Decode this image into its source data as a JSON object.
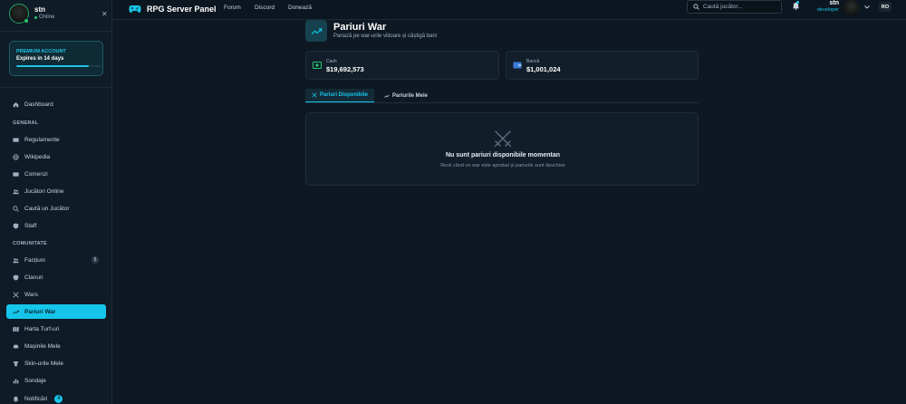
{
  "app": {
    "title": "RPG Server Panel"
  },
  "topnav": [
    "Forum",
    "Discord",
    "Donează"
  ],
  "search": {
    "placeholder": "Caută jucător..."
  },
  "user": {
    "name": "stn",
    "status": "Online",
    "role": "developer"
  },
  "language": "RO",
  "premium": {
    "title": "PREMIUM ACCOUNT",
    "expires": "Expires in 14 days",
    "progress_percent": 85
  },
  "sidebar": {
    "dashboard": "Dashboard",
    "general_title": "GENERAL",
    "general": [
      "Regulamente",
      "Wikipedia",
      "Comenzi",
      "Jucători Online",
      "Caută un Jucător",
      "Staff"
    ],
    "community_title": "COMUNITATE",
    "community": [
      "Facțiuni",
      "Clanuri",
      "Wars",
      "Pariuri War",
      "Harta Turf-uri",
      "Mașinile Mele",
      "Skin-urile Mele",
      "Sondaje",
      "Notificări"
    ],
    "factions_badge": "5",
    "notifications_badge": "4"
  },
  "page": {
    "title": "Pariuri War",
    "subtitle": "Pariază pe war-urile viitoare și câștigă bani"
  },
  "cards": {
    "cash": {
      "label": "Cash",
      "value": "$19,692,573"
    },
    "bank": {
      "label": "Bancă",
      "value": "$1,001,024"
    }
  },
  "tabs": {
    "available": "Pariuri Disponibile",
    "mine": "Pariurile Mele"
  },
  "empty": {
    "title": "Nu sunt pariuri disponibile momentan",
    "subtitle": "Revii când un war este aprobat și pariurile sunt deschise"
  },
  "colors": {
    "accent": "#15c5ea",
    "online": "#28c76f",
    "background": "#0e1822"
  }
}
